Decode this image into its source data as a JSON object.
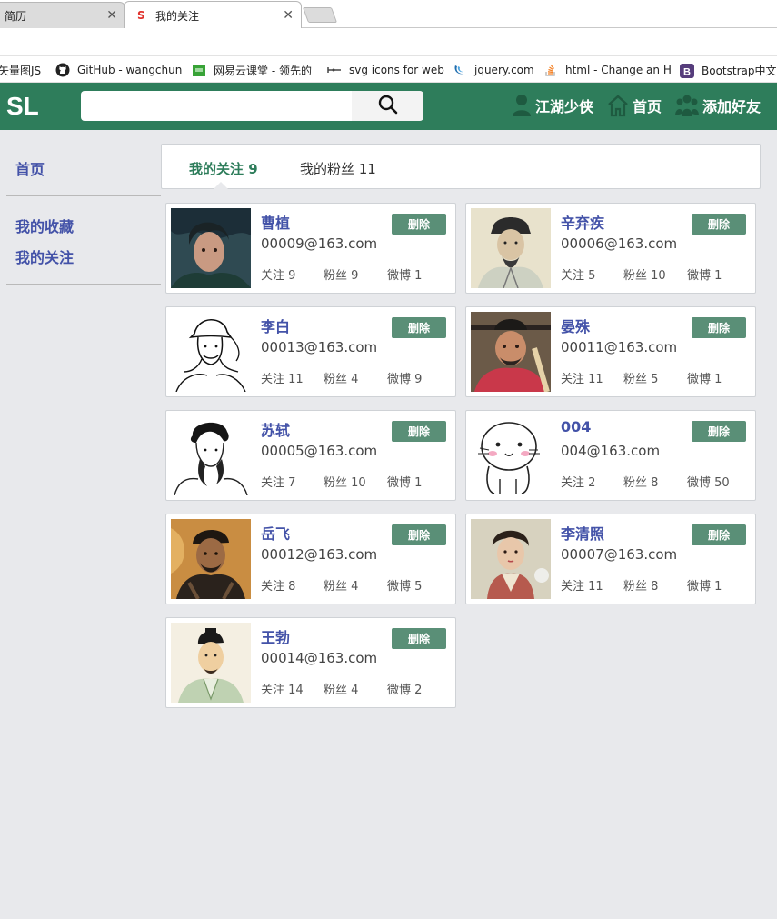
{
  "browser": {
    "tabs": [
      {
        "label": "简历",
        "active": false
      },
      {
        "label": "我的关注",
        "active": true
      }
    ],
    "close_glyph": "✕",
    "bookmarks": [
      {
        "label": "矢量图JS",
        "icon": "bookmark-icon"
      },
      {
        "label": "GitHub - wangchun",
        "icon": "github-icon"
      },
      {
        "label": "网易云课堂 - 领先的",
        "icon": "netease-icon"
      },
      {
        "label": "svg icons for web",
        "icon": "svg-icon"
      },
      {
        "label": "jquery.com",
        "icon": "jquery-icon"
      },
      {
        "label": "html - Change an H",
        "icon": "stackoverflow-icon"
      },
      {
        "label": "Bootstrap中文网",
        "icon": "bootstrap-icon"
      }
    ]
  },
  "header": {
    "logo": "SL",
    "search_placeholder": "",
    "nav": [
      {
        "label": "江湖少侠",
        "icon": "user-icon"
      },
      {
        "label": "首页",
        "icon": "home-icon"
      },
      {
        "label": "添加好友",
        "icon": "group-icon"
      }
    ]
  },
  "sidebar": {
    "sections": [
      [
        "首页"
      ],
      [
        "我的收藏",
        "我的关注"
      ]
    ]
  },
  "tabs": {
    "following": "我的关注 9",
    "followers": "我的粉丝 11"
  },
  "delete_label": "删除",
  "users": [
    {
      "name": "曹植",
      "email": "00009@163.com",
      "following": "关注 9",
      "fans": "粉丝 9",
      "weibo": "微博 1"
    },
    {
      "name": "辛弃疾",
      "email": "00006@163.com",
      "following": "关注 5",
      "fans": "粉丝 10",
      "weibo": "微博 1"
    },
    {
      "name": "李白",
      "email": "00013@163.com",
      "following": "关注 11",
      "fans": "粉丝 4",
      "weibo": "微博 9"
    },
    {
      "name": "晏殊",
      "email": "00011@163.com",
      "following": "关注 11",
      "fans": "粉丝 5",
      "weibo": "微博 1"
    },
    {
      "name": "苏轼",
      "email": "00005@163.com",
      "following": "关注 7",
      "fans": "粉丝 10",
      "weibo": "微博 1"
    },
    {
      "name": "004",
      "email": "004@163.com",
      "following": "关注 2",
      "fans": "粉丝 8",
      "weibo": "微博 50"
    },
    {
      "name": "岳飞",
      "email": "00012@163.com",
      "following": "关注 8",
      "fans": "粉丝 4",
      "weibo": "微博 5"
    },
    {
      "name": "李清照",
      "email": "00007@163.com",
      "following": "关注 11",
      "fans": "粉丝 8",
      "weibo": "微博 1"
    },
    {
      "name": "王勃",
      "email": "00014@163.com",
      "following": "关注 14",
      "fans": "粉丝 4",
      "weibo": "微博 2"
    }
  ],
  "colors": {
    "brand": "#2e7d5b",
    "link": "#4352a8",
    "delete_button": "#5a8f77"
  }
}
